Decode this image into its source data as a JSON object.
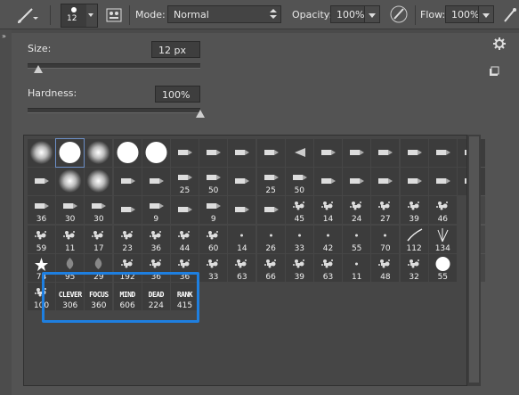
{
  "toolbar": {
    "brush_size": "12",
    "mode_label": "Mode:",
    "mode_value": "Normal",
    "opacity_label": "Opacity:",
    "opacity_value": "100%",
    "flow_label": "Flow:",
    "flow_value": "100%"
  },
  "brush_panel": {
    "size_label": "Size:",
    "size_value": "12 px",
    "hardness_label": "Hardness:",
    "hardness_value": "100%",
    "size_fraction": 0.06,
    "hardness_fraction": 1.0
  },
  "presets": [
    {
      "type": "soft",
      "label": ""
    },
    {
      "type": "hard",
      "label": "",
      "selected": true
    },
    {
      "type": "soft",
      "label": ""
    },
    {
      "type": "hard",
      "label": ""
    },
    {
      "type": "hard",
      "label": ""
    },
    {
      "type": "tip",
      "label": ""
    },
    {
      "type": "tip",
      "label": ""
    },
    {
      "type": "tip",
      "label": ""
    },
    {
      "type": "tip",
      "label": ""
    },
    {
      "type": "fan",
      "label": ""
    },
    {
      "type": "tip",
      "label": ""
    },
    {
      "type": "tip",
      "label": ""
    },
    {
      "type": "tip",
      "label": ""
    },
    {
      "type": "tip",
      "label": ""
    },
    {
      "type": "tip",
      "label": ""
    },
    {
      "type": "tip",
      "label": ""
    },
    {
      "type": "tip",
      "label": ""
    },
    {
      "type": "soft",
      "label": ""
    },
    {
      "type": "soft",
      "label": ""
    },
    {
      "type": "tip",
      "label": ""
    },
    {
      "type": "tip",
      "label": ""
    },
    {
      "type": "tip",
      "label": "25"
    },
    {
      "type": "tip",
      "label": "50"
    },
    {
      "type": "tip",
      "label": ""
    },
    {
      "type": "tip",
      "label": "25"
    },
    {
      "type": "tip",
      "label": "50"
    },
    {
      "type": "tip",
      "label": ""
    },
    {
      "type": "tip",
      "label": ""
    },
    {
      "type": "tip",
      "label": ""
    },
    {
      "type": "tip",
      "label": ""
    },
    {
      "type": "tip",
      "label": ""
    },
    {
      "type": "tip",
      "label": ""
    },
    {
      "type": "tip",
      "label": "36"
    },
    {
      "type": "tip",
      "label": "30"
    },
    {
      "type": "tip",
      "label": "30"
    },
    {
      "type": "tip",
      "label": ""
    },
    {
      "type": "tip",
      "label": "9"
    },
    {
      "type": "tip",
      "label": ""
    },
    {
      "type": "tip",
      "label": "9"
    },
    {
      "type": "tip",
      "label": ""
    },
    {
      "type": "tip",
      "label": ""
    },
    {
      "type": "splat",
      "label": "45"
    },
    {
      "type": "splat",
      "label": "14"
    },
    {
      "type": "splat",
      "label": "24"
    },
    {
      "type": "splat",
      "label": "27"
    },
    {
      "type": "splat",
      "label": "39"
    },
    {
      "type": "splat",
      "label": "46"
    },
    {
      "type": "blank",
      "label": ""
    },
    {
      "type": "splat",
      "label": "59"
    },
    {
      "type": "splat",
      "label": "11"
    },
    {
      "type": "splat",
      "label": "17"
    },
    {
      "type": "splat",
      "label": "23"
    },
    {
      "type": "splat",
      "label": "36"
    },
    {
      "type": "splat",
      "label": "44"
    },
    {
      "type": "splat",
      "label": "60"
    },
    {
      "type": "dot",
      "label": "14"
    },
    {
      "type": "dot",
      "label": "26"
    },
    {
      "type": "dot",
      "label": "33"
    },
    {
      "type": "dot",
      "label": "42"
    },
    {
      "type": "dot",
      "label": "55"
    },
    {
      "type": "dot",
      "label": "70"
    },
    {
      "type": "curve",
      "label": "112"
    },
    {
      "type": "grass",
      "label": "134"
    },
    {
      "type": "blank",
      "label": ""
    },
    {
      "type": "star",
      "label": "74"
    },
    {
      "type": "leaf",
      "label": "95"
    },
    {
      "type": "leaf",
      "label": "29"
    },
    {
      "type": "splat",
      "label": "192"
    },
    {
      "type": "splat",
      "label": "36"
    },
    {
      "type": "splat",
      "label": "36"
    },
    {
      "type": "splat",
      "label": "33"
    },
    {
      "type": "splat",
      "label": "63"
    },
    {
      "type": "splat",
      "label": "66"
    },
    {
      "type": "splat",
      "label": "39"
    },
    {
      "type": "splat",
      "label": "63"
    },
    {
      "type": "dot",
      "label": "11"
    },
    {
      "type": "splat",
      "label": "48"
    },
    {
      "type": "splat",
      "label": "32"
    },
    {
      "type": "hard",
      "label": "55"
    },
    {
      "type": "blank",
      "label": ""
    },
    {
      "type": "splat",
      "label": "100"
    },
    {
      "type": "word",
      "word": "CLEVER",
      "label": "306"
    },
    {
      "type": "word",
      "word": "FOCUS",
      "label": "360"
    },
    {
      "type": "word",
      "word": "MIND",
      "label": "606"
    },
    {
      "type": "word",
      "word": "DEAD",
      "label": "224"
    },
    {
      "type": "word",
      "word": "RANK",
      "label": "415"
    }
  ]
}
